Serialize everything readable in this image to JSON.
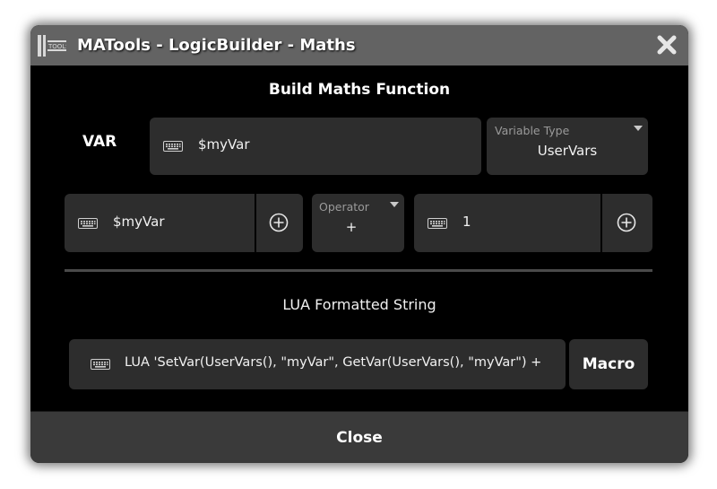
{
  "window": {
    "title": "MATools - LogicBuilder - Maths",
    "logo_icon": "matools-logo-icon",
    "close_icon": "close-x-icon"
  },
  "builder": {
    "heading": "Build Maths Function",
    "var_label": "VAR",
    "var_input": {
      "value": "$myVar",
      "icon": "keyboard-icon"
    },
    "variable_type": {
      "label": "Variable Type",
      "value": "UserVars",
      "icon": "dropdown-arrow-icon"
    }
  },
  "expression": {
    "left_operand": {
      "value": "$myVar",
      "icon": "keyboard-icon",
      "add_icon": "circle-plus-icon"
    },
    "operator": {
      "label": "Operator",
      "value": "+",
      "icon": "dropdown-arrow-icon"
    },
    "right_operand": {
      "value": "1",
      "icon": "keyboard-icon",
      "add_icon": "circle-plus-icon"
    }
  },
  "output": {
    "heading": "LUA Formatted String",
    "lua_string": "LUA 'SetVar(UserVars(), \"myVar\", GetVar(UserVars(), \"myVar\") +",
    "icon": "keyboard-icon",
    "macro_button": "Macro"
  },
  "footer": {
    "close_label": "Close"
  },
  "colors": {
    "background": "#000000",
    "titlebar": "#636363",
    "field": "#2d2d2d",
    "footer": "#3a3a3a",
    "text": "#ffffff",
    "muted": "#9a9a9a"
  }
}
